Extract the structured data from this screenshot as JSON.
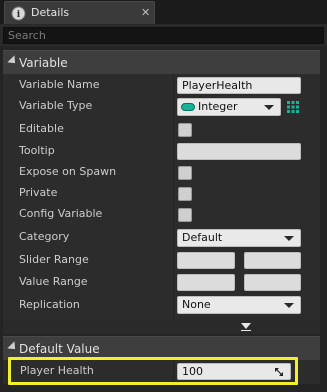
{
  "window": {
    "tab_title": "Details"
  },
  "search": {
    "placeholder": "Search"
  },
  "variable_section": {
    "title": "Variable",
    "rows": {
      "variable_name": {
        "label": "Variable Name",
        "value": "PlayerHealth"
      },
      "variable_type": {
        "label": "Variable Type",
        "value": "Integer"
      },
      "editable": {
        "label": "Editable"
      },
      "tooltip": {
        "label": "Tooltip"
      },
      "expose_on_spawn": {
        "label": "Expose on Spawn"
      },
      "private": {
        "label": "Private"
      },
      "config_variable": {
        "label": "Config Variable"
      },
      "category": {
        "label": "Category",
        "value": "Default"
      },
      "slider_range": {
        "label": "Slider Range"
      },
      "value_range": {
        "label": "Value Range"
      },
      "replication": {
        "label": "Replication",
        "value": "None"
      }
    }
  },
  "default_value_section": {
    "title": "Default Value",
    "player_health": {
      "label": "Player Health",
      "value": "100"
    }
  },
  "colors": {
    "highlight": "#f3ef2b",
    "integer_pin": "#16b39a"
  }
}
